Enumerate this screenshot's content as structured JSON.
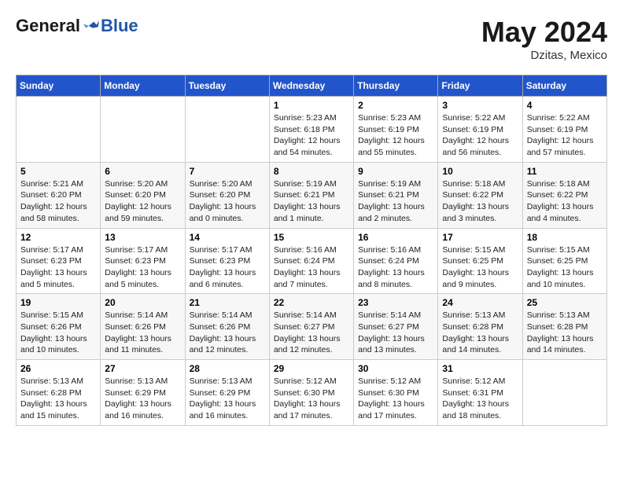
{
  "logo": {
    "general": "General",
    "blue": "Blue"
  },
  "title": {
    "month_year": "May 2024",
    "location": "Dzitas, Mexico"
  },
  "weekdays": [
    "Sunday",
    "Monday",
    "Tuesday",
    "Wednesday",
    "Thursday",
    "Friday",
    "Saturday"
  ],
  "weeks": [
    [
      {
        "day": "",
        "info": ""
      },
      {
        "day": "",
        "info": ""
      },
      {
        "day": "",
        "info": ""
      },
      {
        "day": "1",
        "info": "Sunrise: 5:23 AM\nSunset: 6:18 PM\nDaylight: 12 hours\nand 54 minutes."
      },
      {
        "day": "2",
        "info": "Sunrise: 5:23 AM\nSunset: 6:19 PM\nDaylight: 12 hours\nand 55 minutes."
      },
      {
        "day": "3",
        "info": "Sunrise: 5:22 AM\nSunset: 6:19 PM\nDaylight: 12 hours\nand 56 minutes."
      },
      {
        "day": "4",
        "info": "Sunrise: 5:22 AM\nSunset: 6:19 PM\nDaylight: 12 hours\nand 57 minutes."
      }
    ],
    [
      {
        "day": "5",
        "info": "Sunrise: 5:21 AM\nSunset: 6:20 PM\nDaylight: 12 hours\nand 58 minutes."
      },
      {
        "day": "6",
        "info": "Sunrise: 5:20 AM\nSunset: 6:20 PM\nDaylight: 12 hours\nand 59 minutes."
      },
      {
        "day": "7",
        "info": "Sunrise: 5:20 AM\nSunset: 6:20 PM\nDaylight: 13 hours\nand 0 minutes."
      },
      {
        "day": "8",
        "info": "Sunrise: 5:19 AM\nSunset: 6:21 PM\nDaylight: 13 hours\nand 1 minute."
      },
      {
        "day": "9",
        "info": "Sunrise: 5:19 AM\nSunset: 6:21 PM\nDaylight: 13 hours\nand 2 minutes."
      },
      {
        "day": "10",
        "info": "Sunrise: 5:18 AM\nSunset: 6:22 PM\nDaylight: 13 hours\nand 3 minutes."
      },
      {
        "day": "11",
        "info": "Sunrise: 5:18 AM\nSunset: 6:22 PM\nDaylight: 13 hours\nand 4 minutes."
      }
    ],
    [
      {
        "day": "12",
        "info": "Sunrise: 5:17 AM\nSunset: 6:23 PM\nDaylight: 13 hours\nand 5 minutes."
      },
      {
        "day": "13",
        "info": "Sunrise: 5:17 AM\nSunset: 6:23 PM\nDaylight: 13 hours\nand 5 minutes."
      },
      {
        "day": "14",
        "info": "Sunrise: 5:17 AM\nSunset: 6:23 PM\nDaylight: 13 hours\nand 6 minutes."
      },
      {
        "day": "15",
        "info": "Sunrise: 5:16 AM\nSunset: 6:24 PM\nDaylight: 13 hours\nand 7 minutes."
      },
      {
        "day": "16",
        "info": "Sunrise: 5:16 AM\nSunset: 6:24 PM\nDaylight: 13 hours\nand 8 minutes."
      },
      {
        "day": "17",
        "info": "Sunrise: 5:15 AM\nSunset: 6:25 PM\nDaylight: 13 hours\nand 9 minutes."
      },
      {
        "day": "18",
        "info": "Sunrise: 5:15 AM\nSunset: 6:25 PM\nDaylight: 13 hours\nand 10 minutes."
      }
    ],
    [
      {
        "day": "19",
        "info": "Sunrise: 5:15 AM\nSunset: 6:26 PM\nDaylight: 13 hours\nand 10 minutes."
      },
      {
        "day": "20",
        "info": "Sunrise: 5:14 AM\nSunset: 6:26 PM\nDaylight: 13 hours\nand 11 minutes."
      },
      {
        "day": "21",
        "info": "Sunrise: 5:14 AM\nSunset: 6:26 PM\nDaylight: 13 hours\nand 12 minutes."
      },
      {
        "day": "22",
        "info": "Sunrise: 5:14 AM\nSunset: 6:27 PM\nDaylight: 13 hours\nand 12 minutes."
      },
      {
        "day": "23",
        "info": "Sunrise: 5:14 AM\nSunset: 6:27 PM\nDaylight: 13 hours\nand 13 minutes."
      },
      {
        "day": "24",
        "info": "Sunrise: 5:13 AM\nSunset: 6:28 PM\nDaylight: 13 hours\nand 14 minutes."
      },
      {
        "day": "25",
        "info": "Sunrise: 5:13 AM\nSunset: 6:28 PM\nDaylight: 13 hours\nand 14 minutes."
      }
    ],
    [
      {
        "day": "26",
        "info": "Sunrise: 5:13 AM\nSunset: 6:28 PM\nDaylight: 13 hours\nand 15 minutes."
      },
      {
        "day": "27",
        "info": "Sunrise: 5:13 AM\nSunset: 6:29 PM\nDaylight: 13 hours\nand 16 minutes."
      },
      {
        "day": "28",
        "info": "Sunrise: 5:13 AM\nSunset: 6:29 PM\nDaylight: 13 hours\nand 16 minutes."
      },
      {
        "day": "29",
        "info": "Sunrise: 5:12 AM\nSunset: 6:30 PM\nDaylight: 13 hours\nand 17 minutes."
      },
      {
        "day": "30",
        "info": "Sunrise: 5:12 AM\nSunset: 6:30 PM\nDaylight: 13 hours\nand 17 minutes."
      },
      {
        "day": "31",
        "info": "Sunrise: 5:12 AM\nSunset: 6:31 PM\nDaylight: 13 hours\nand 18 minutes."
      },
      {
        "day": "",
        "info": ""
      }
    ]
  ]
}
